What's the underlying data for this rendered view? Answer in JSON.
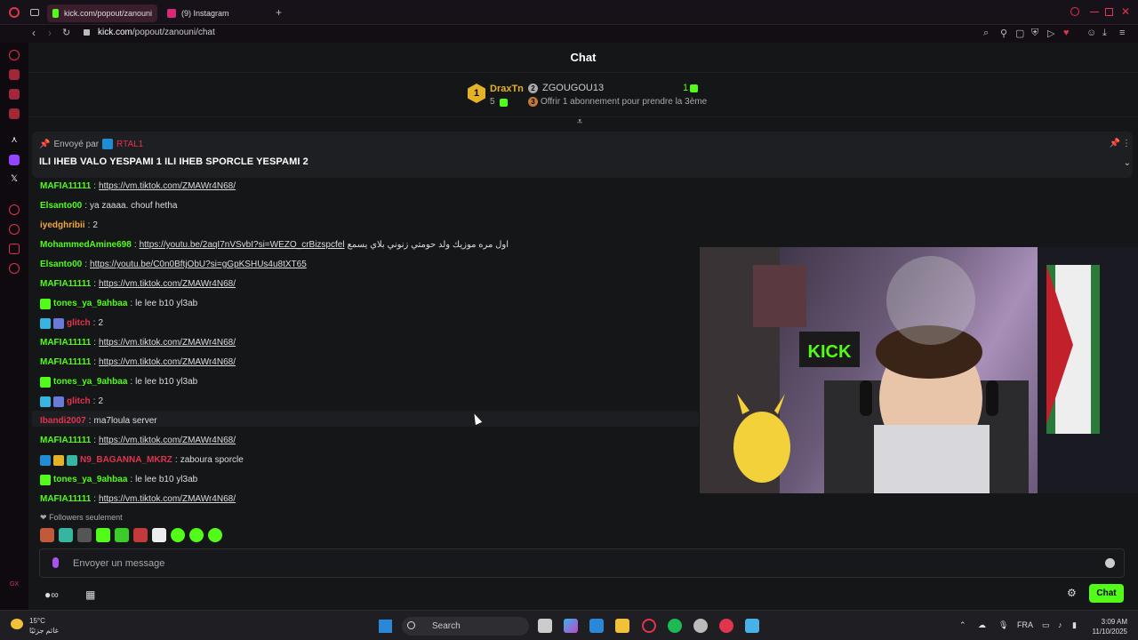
{
  "browser": {
    "tabs": [
      {
        "label": "kick.com/popout/zanouni",
        "favicon_color": "#53fc18"
      },
      {
        "label": "(9) Instagram",
        "favicon_color": "#d62976"
      }
    ],
    "url_domain": "kick.com",
    "url_path": "/popout/zanouni/chat"
  },
  "chat": {
    "title": "Chat",
    "leaderboard": {
      "first": {
        "rank": "1",
        "name": "DraxTn",
        "count": "5"
      },
      "second": {
        "rank": "2",
        "name": "ZGOUGOU13",
        "count": "1"
      },
      "third": {
        "rank": "3",
        "text": "Offrir 1 abonnement pour prendre la 3ème"
      }
    },
    "pinned": {
      "sent_by": "Envoyé par",
      "user": "RTAL1",
      "text": "ILI IHEB VALO YESPAMI 1 ILI IHEB SPORCLE YESPAMI 2"
    },
    "messages": [
      {
        "user": "MAFIA11111",
        "color": "#53fc18",
        "text": "https://vm.tiktok.com/ZMAWr4N68/",
        "link": true
      },
      {
        "user": "Elsanto00",
        "color": "#53fc18",
        "text": "ya zaaaa. chouf hetha",
        "link": false
      },
      {
        "user": "iyedghribii",
        "color": "#f2a73b",
        "text": "2",
        "link": false
      },
      {
        "user": "MohammedAmine698",
        "color": "#53fc18",
        "text": "https://youtu.be/2aqI7nVSvbI?si=WEZO_crBizspcfel",
        "link": true,
        "extra": "اول مره موزيك ولد حومتي زنوني بلاي يسمع"
      },
      {
        "user": "Elsanto00",
        "color": "#53fc18",
        "text": "https://youtu.be/C0n0BftjObU?si=gGpKSHUs4u8tXT65",
        "link": true
      },
      {
        "user": "MAFIA11111",
        "color": "#53fc18",
        "text": "https://vm.tiktok.com/ZMAWr4N68/",
        "link": true
      },
      {
        "user": "tones_ya_9ahbaa",
        "color": "#53fc18",
        "text": "le lee b10 yl3ab",
        "link": false
      },
      {
        "user": "glitch",
        "color": "#e0344f",
        "text": "2",
        "link": false
      },
      {
        "user": "MAFIA11111",
        "color": "#53fc18",
        "text": "https://vm.tiktok.com/ZMAWr4N68/",
        "link": true
      },
      {
        "user": "MAFIA11111",
        "color": "#53fc18",
        "text": "https://vm.tiktok.com/ZMAWr4N68/",
        "link": true
      },
      {
        "user": "tones_ya_9ahbaa",
        "color": "#53fc18",
        "text": "le lee b10 yl3ab",
        "link": false
      },
      {
        "user": "glitch",
        "color": "#e0344f",
        "text": "2",
        "link": false
      },
      {
        "user": "Ibandi2007",
        "color": "#e0344f",
        "text": "ma7loula server",
        "link": false
      },
      {
        "user": "MAFIA11111",
        "color": "#53fc18",
        "text": "https://vm.tiktok.com/ZMAWr4N68/",
        "link": true
      },
      {
        "user": "N9_BAGANNA_MKRZ",
        "color": "#e0344f",
        "text": "zaboura sporcle",
        "link": false
      },
      {
        "user": "tones_ya_9ahbaa",
        "color": "#53fc18",
        "text": "le lee b10 yl3ab",
        "link": false
      },
      {
        "user": "MAFIA11111",
        "color": "#53fc18",
        "text": "https://vm.tiktok.com/ZMAWr4N68/",
        "link": true
      }
    ],
    "followers_only": "Followers seulement",
    "input_placeholder": "Envoyer un message",
    "chat_button": "Chat"
  },
  "video": {
    "sign_text": "KICK"
  },
  "taskbar": {
    "temp": "15°C",
    "weather_desc": "غائم جزئيًا",
    "search_label": "Search",
    "lang": "FRA",
    "time": "3:09 AM",
    "date": "11/10/2025"
  },
  "colors": {
    "kick_green": "#53fc18",
    "accent_red": "#e0344f"
  }
}
